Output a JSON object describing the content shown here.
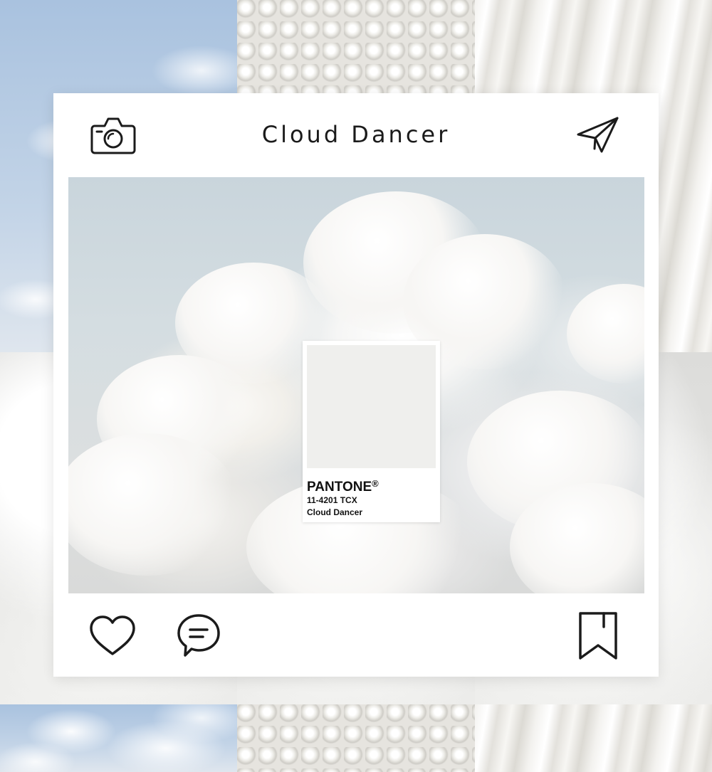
{
  "post": {
    "title": "Cloud Dancer"
  },
  "swatch": {
    "brand": "PANTONE",
    "registered": "®",
    "code": "11-4201 TCX",
    "name": "Cloud Dancer",
    "color": "#efefed"
  },
  "icons": {
    "header_left": "camera-icon",
    "header_right": "paper-plane-icon",
    "footer_like": "heart-icon",
    "footer_comment": "comment-bubble-icon",
    "footer_save": "bookmark-icon"
  },
  "colors": {
    "icon_stroke": "#1b1b1b",
    "card_background": "#ffffff"
  }
}
